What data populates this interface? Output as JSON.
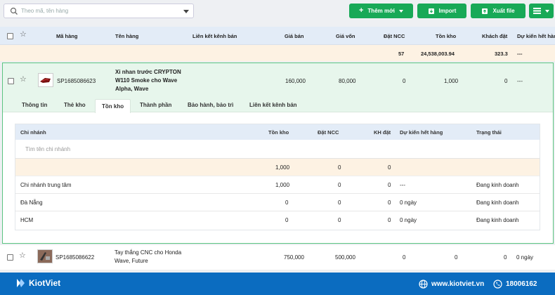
{
  "search": {
    "placeholder": "Theo mã, tên hàng",
    "value": ""
  },
  "toolbar": {
    "create_label": "Thêm mới",
    "import_label": "Import",
    "export_label": "Xuất file",
    "accent": "#18a957"
  },
  "table": {
    "columns": [
      "Mã hàng",
      "Tên hàng",
      "Liên kết kênh bán",
      "Giá bán",
      "Giá vốn",
      "Đặt NCC",
      "Tồn kho",
      "Khách đặt",
      "Dự kiến hết hàng"
    ],
    "summary": {
      "dat_ncc": "57",
      "ton_kho": "24,538,003.94",
      "khach_dat": "323.3",
      "du_kien": "---"
    }
  },
  "products": [
    {
      "code": "SP1685086623",
      "name": "Xi nhan trước CRYPTON W110 Smoke cho Wave Alpha, Wave",
      "gia_ban": "160,000",
      "gia_von": "80,000",
      "dat_ncc": "0",
      "ton_kho": "1,000",
      "khach_dat": "0",
      "du_kien": "---"
    },
    {
      "code": "SP1685086622",
      "name": "Tay thắng CNC cho Honda Wave, Future",
      "gia_ban": "750,000",
      "gia_von": "500,000",
      "dat_ncc": "0",
      "ton_kho": "0",
      "khach_dat": "0",
      "du_kien": "0 ngày"
    }
  ],
  "tabs": [
    "Thông tin",
    "Thẻ kho",
    "Tồn kho",
    "Thành phần",
    "Bảo hành, bảo trì",
    "Liên kết kênh bán"
  ],
  "active_tab": "Tồn kho",
  "branch_table": {
    "columns": [
      "Chi nhánh",
      "Tồn kho",
      "Đặt NCC",
      "KH đặt",
      "Dự kiến hết hàng",
      "Trạng thái"
    ],
    "search_placeholder": "Tìm tên chi nhánh",
    "total": {
      "ton_kho": "1,000",
      "dat_ncc": "0",
      "kh_dat": "0"
    },
    "rows": [
      {
        "name": "Chi nhánh trung tâm",
        "ton_kho": "1,000",
        "dat_ncc": "0",
        "kh_dat": "0",
        "du_kien": "---",
        "status": "Đang kinh doanh"
      },
      {
        "name": "Đà Nẵng",
        "ton_kho": "0",
        "dat_ncc": "0",
        "kh_dat": "0",
        "du_kien": "0 ngày",
        "status": "Đang kinh doanh"
      },
      {
        "name": "HCM",
        "ton_kho": "0",
        "dat_ncc": "0",
        "kh_dat": "0",
        "du_kien": "0 ngày",
        "status": "Đang kinh doanh"
      }
    ]
  },
  "footer": {
    "brand": "KiotViet",
    "website": "www.kiotviet.vn",
    "hotline": "18006162",
    "color": "#0b6cc0"
  }
}
